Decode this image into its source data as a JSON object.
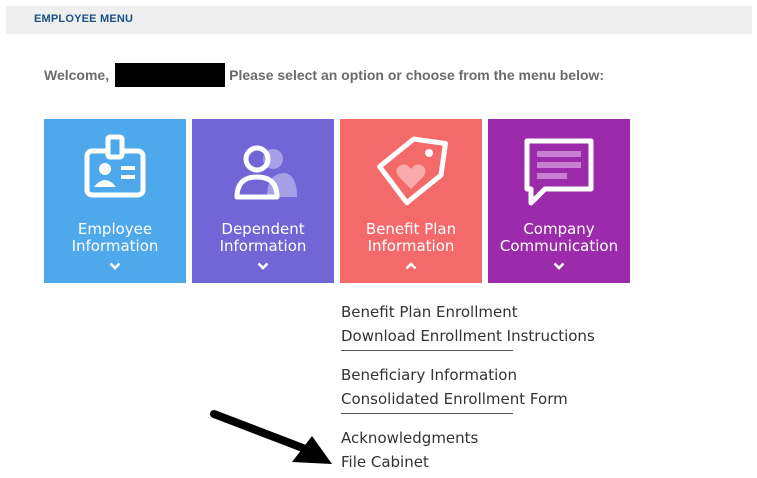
{
  "header": {
    "title": "EMPLOYEE MENU"
  },
  "welcome": {
    "greeting": "Welcome,",
    "prompt": "Please select an option or choose from the menu below:"
  },
  "tiles": [
    {
      "line1": "Employee",
      "line2": "Information",
      "icon": "id-badge-icon",
      "color": "#4ea8ec",
      "expanded": false
    },
    {
      "line1": "Dependent",
      "line2": "Information",
      "icon": "users-icon",
      "color": "#7265d6",
      "expanded": false
    },
    {
      "line1": "Benefit Plan",
      "line2": "Information",
      "icon": "tag-heart-icon",
      "color": "#f46a6a",
      "expanded": true
    },
    {
      "line1": "Company",
      "line2": "Communication",
      "icon": "message-icon",
      "color": "#9c2bab",
      "expanded": false
    }
  ],
  "submenu": {
    "items": [
      "Benefit Plan Enrollment",
      "Download Enrollment Instructions",
      "Beneficiary Information",
      "Consolidated Enrollment Form",
      "Acknowledgments",
      "File Cabinet"
    ]
  }
}
